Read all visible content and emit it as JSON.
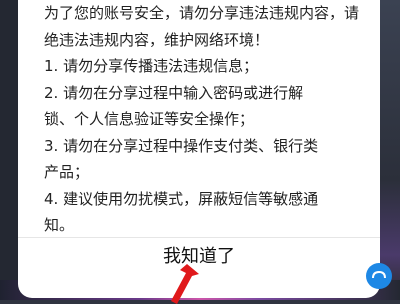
{
  "dialog": {
    "message_lines": [
      "为了您的账号安全，请勿分享违法违规内容，请",
      "绝违法违规内容，维护网络环境！",
      "1. 请勿分享传播违法违规信息；",
      "2. 请勿在分享过程中输入密码或进行解",
      "锁、个人信息验证等安全操作；",
      "3. 请勿在分享过程中操作支付类、银行类",
      "产品；",
      "4. 建议使用勿扰模式，屏蔽短信等敏感通",
      "知。"
    ],
    "confirm_label": "我知道了"
  },
  "annotation": {
    "arrow_color": "#e0191b"
  }
}
